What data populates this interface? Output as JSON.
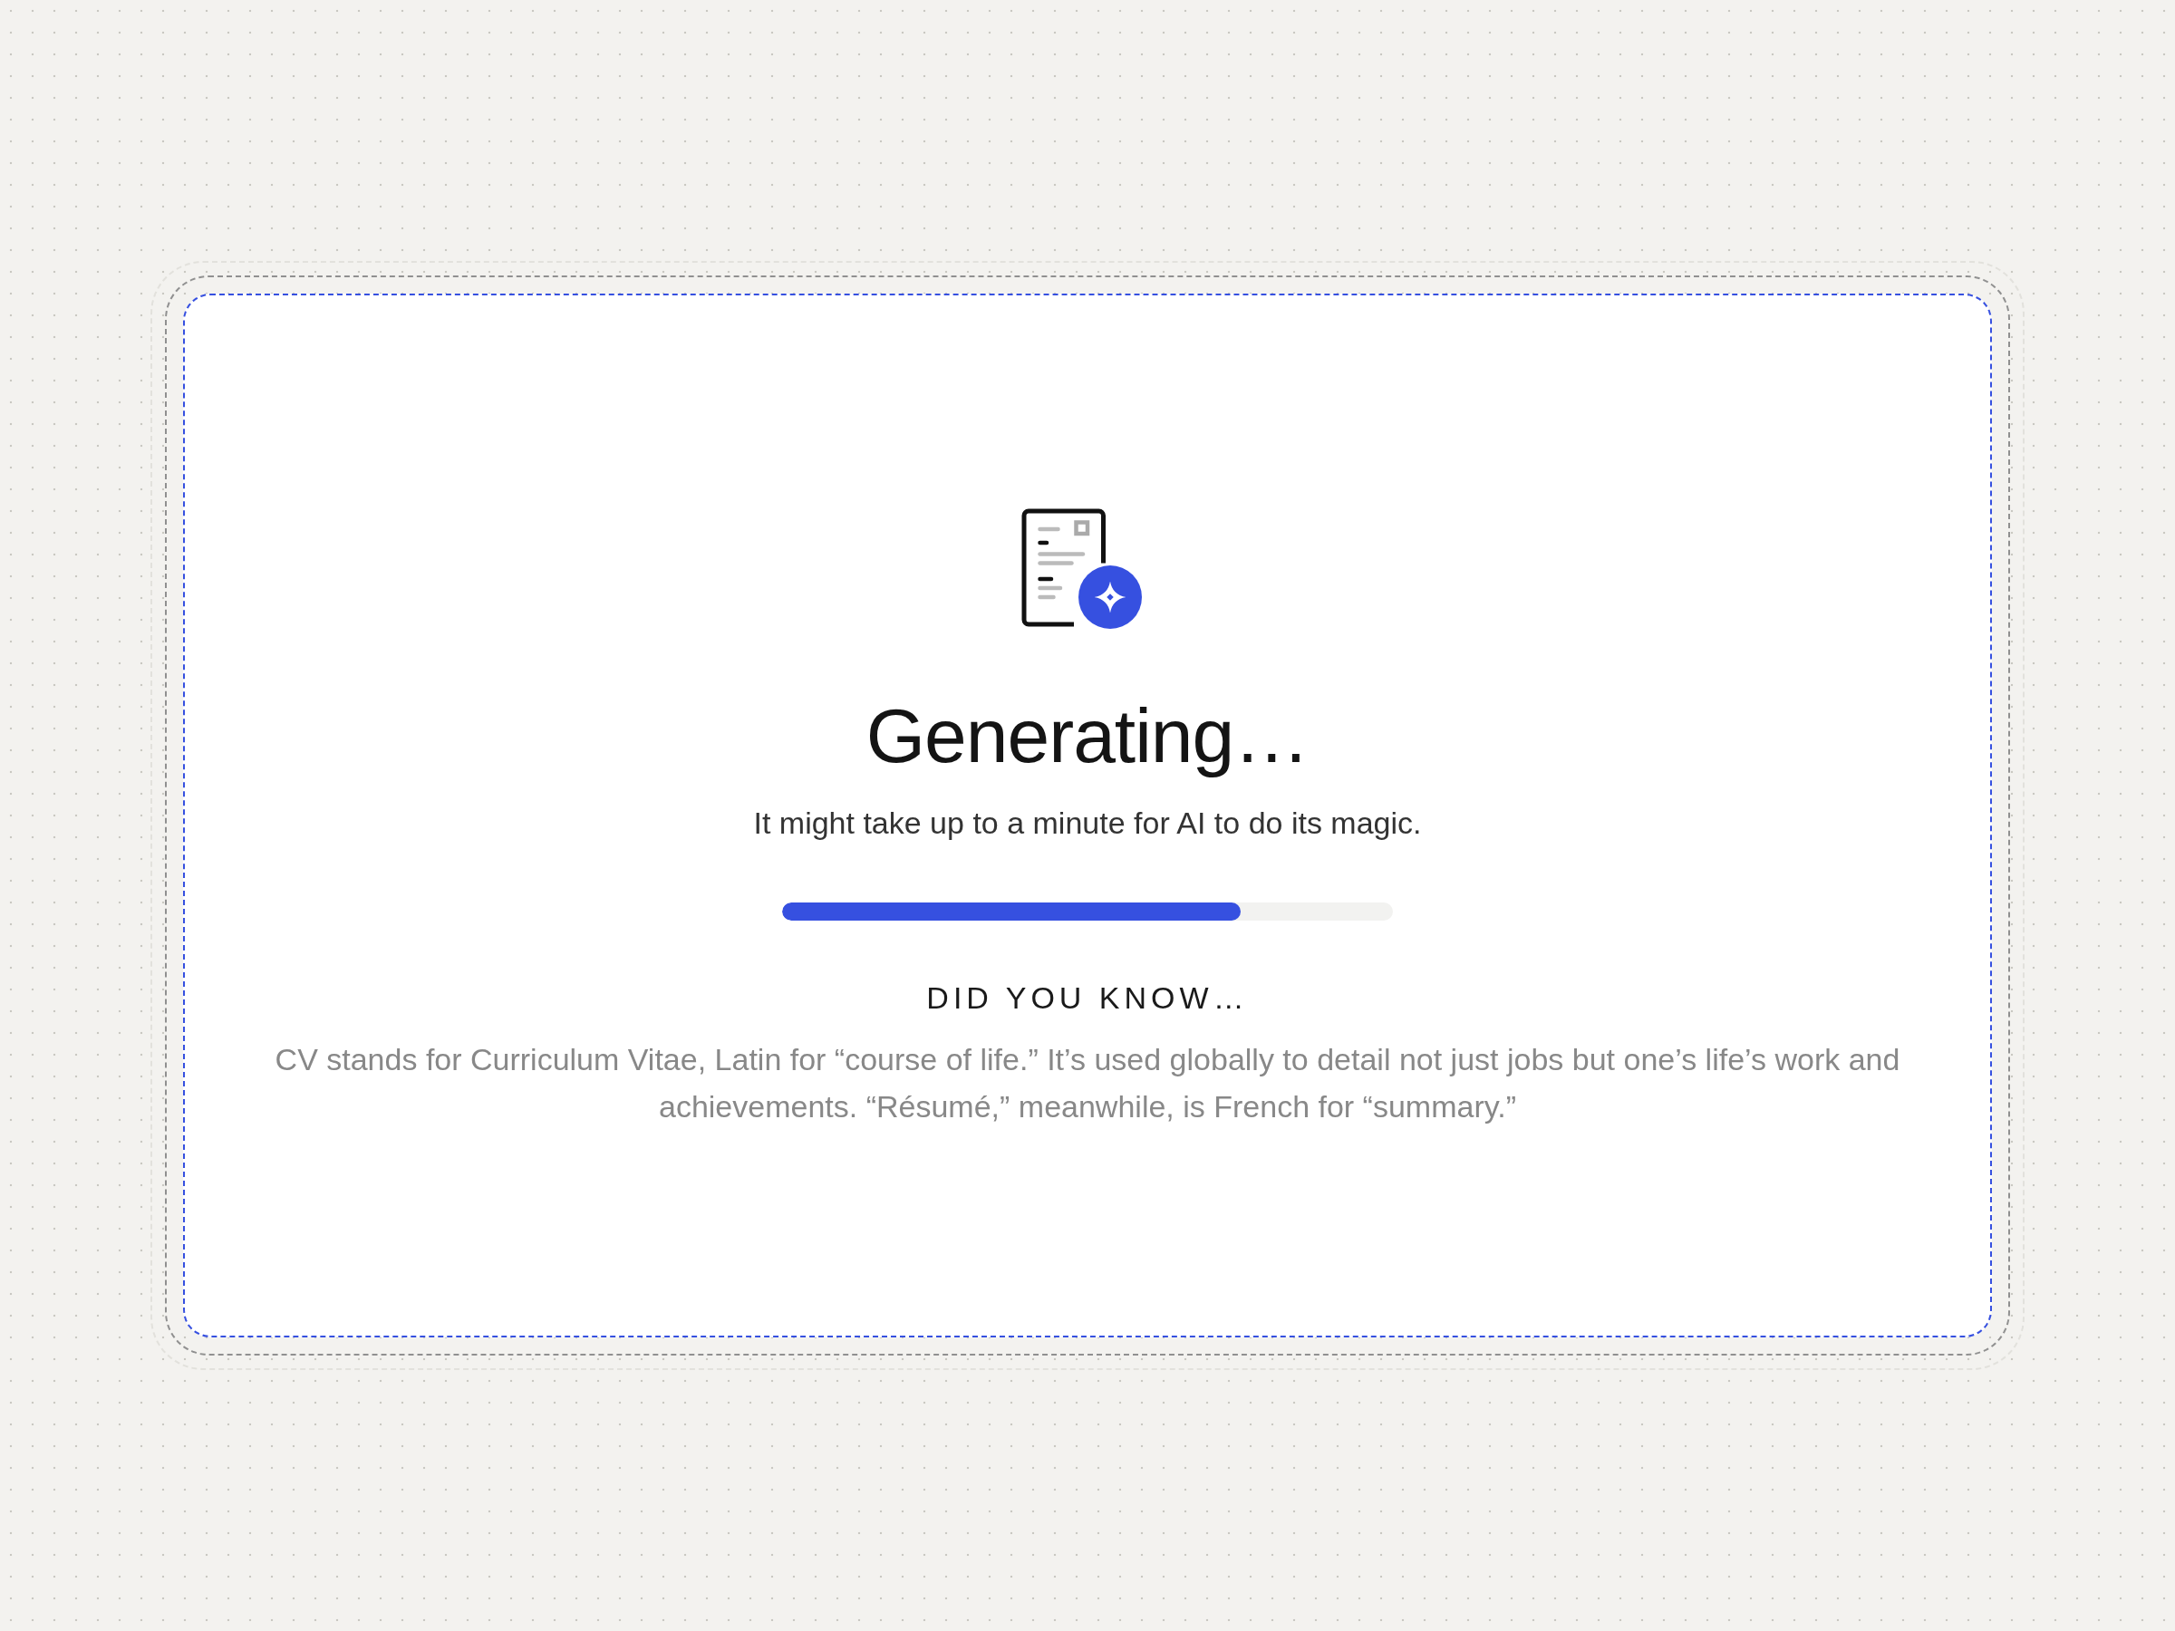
{
  "title": "Generating…",
  "subtitle": "It might take up to a minute for AI to do its magic.",
  "progress": {
    "level": 0.75
  },
  "tip": {
    "heading": "DID YOU KNOW…",
    "text": "CV stands for Curriculum Vitae, Latin for “course of life.” It’s used globally to detail not just jobs but one’s life’s work and achievements. “Résumé,” meanwhile, is French for “summary.”"
  }
}
